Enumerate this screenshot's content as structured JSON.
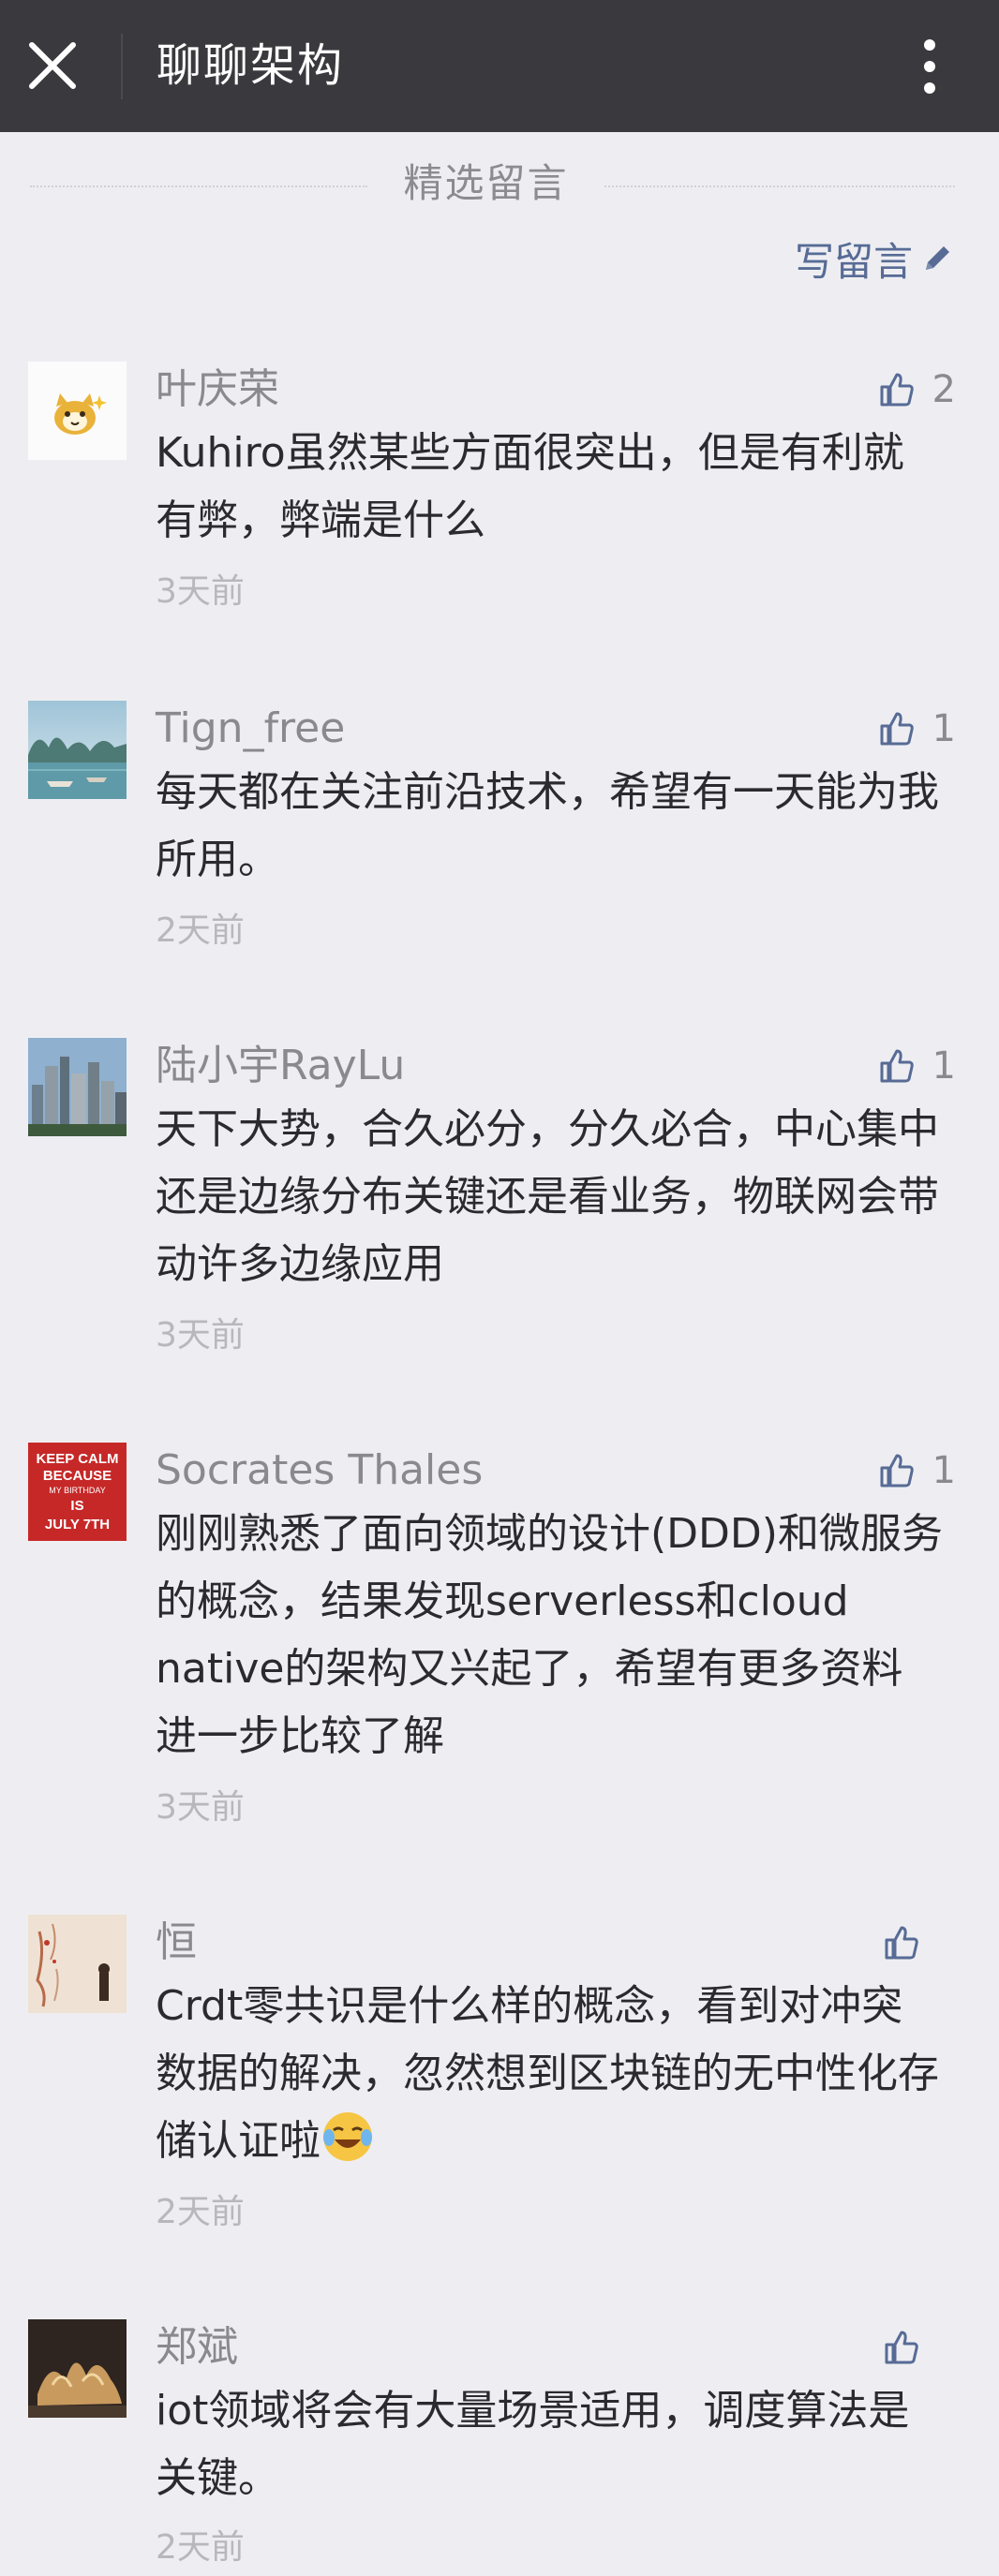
{
  "header": {
    "title": "聊聊架构",
    "close_icon": "close-icon",
    "more_icon": "more-vertical-icon"
  },
  "section": {
    "title": "精选留言",
    "write_label": "写留言",
    "write_icon": "pencil-icon"
  },
  "colors": {
    "topbar": "#3a3a3e",
    "background": "#eeeef2",
    "link": "#576b95",
    "name": "#8a8a8e",
    "text": "#2b2b2f",
    "time": "#b8b8bc"
  },
  "comments": [
    {
      "name": "叶庆荣",
      "likes": "2",
      "text": "Kuhiro虽然某些方面很突出，但是有利就有弊，弊端是什么",
      "time": "3天前",
      "avatar_icon": "cat-avatar-icon"
    },
    {
      "name": "Tign_free",
      "likes": "1",
      "text": "每天都在关注前沿技术，希望有一天能为我所用。",
      "time": "2天前",
      "avatar_icon": "bay-landscape-avatar-icon"
    },
    {
      "name": "陆小宇RayLu",
      "likes": "1",
      "text": "天下大势，合久必分，分久必合，中心集中还是边缘分布关键还是看业务，物联网会带动许多边缘应用",
      "time": "3天前",
      "avatar_icon": "city-skyline-avatar-icon"
    },
    {
      "name": "Socrates Thales",
      "likes": "1",
      "text": "刚刚熟悉了面向领域的设计(DDD)和微服务的概念，结果发现serverless和cloud native的架构又兴起了，希望有更多资料进一步比较了解",
      "time": "3天前",
      "avatar_icon": "keep-calm-poster-avatar-icon",
      "avatar_text": {
        "line1": "KEEP CALM",
        "line2": "BECAUSE",
        "line3": "MY BIRTHDAY",
        "line4": "IS",
        "line5": "JULY 7TH"
      }
    },
    {
      "name": "恒",
      "likes": "",
      "text": "Crdt零共识是什么样的概念，看到对冲突数据的解决，忽然想到区块链的无中性化存储认证啦",
      "emoji": "laughing-tears-emoji",
      "time": "2天前",
      "avatar_icon": "calligraphy-avatar-icon"
    },
    {
      "name": "郑斌",
      "likes": "",
      "text": "iot领域将会有大量场景适用，调度算法是关键。",
      "time": "2天前",
      "avatar_icon": "sculpture-avatar-icon"
    }
  ]
}
